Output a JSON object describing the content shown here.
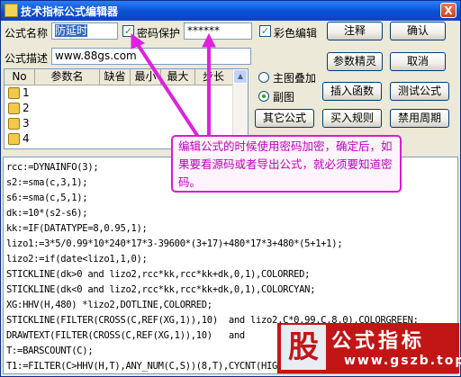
{
  "window": {
    "title": "技术指标公式编辑器",
    "close": "X"
  },
  "form": {
    "name_label": "公式名称",
    "name_value": "防延时",
    "password_protect_label": "密码保护",
    "password_value": "******",
    "color_edit_label": "彩色编辑",
    "desc_label": "公式描述",
    "desc_value": "www.88gs.com"
  },
  "buttons": {
    "annotate": "注释",
    "confirm": "确认",
    "param_wizard": "参数精灵",
    "cancel": "取消",
    "insert_function": "插入函数",
    "test_formula": "测试公式",
    "other_formula": "其它公式",
    "buy_rule": "买入规则",
    "disable_period": "禁用周期"
  },
  "chart_mode": {
    "main_overlay": "主图叠加",
    "subchart": "副图",
    "selected": "副图"
  },
  "param_table": {
    "headers": [
      "No",
      "参数名",
      "缺省",
      "最小",
      "最大",
      "步长"
    ],
    "rows": [
      "1",
      "2",
      "3",
      "4"
    ]
  },
  "callout": {
    "text": "编辑公式的时候使用密码加密，确定后，如果要看源码或者导出公式，就必须要知道密码。"
  },
  "code_lines": [
    "rcc:=DYNAINFO(3);",
    "s2:=sma(c,3,1);",
    "s6:=sma(c,5,1);",
    "dk:=10*(s2-s6);",
    "kk:=IF(DATATYPE=8,0.95,1);",
    "lizo1:=3*5/0.99*10*240*17*3-39600*(3+17)+480*17*3+480*(5+1+1);",
    "lizo2:=if(date<lizo1,1,0);",
    "STICKLINE(dk>0 and lizo2,rcc*kk,rcc*kk+dk,0,1),COLORRED;",
    "STICKLINE(dk<0 and lizo2,rcc*kk,rcc*kk+dk,0,1),COLORCYAN;",
    "XG:HHV(H,480) *lizo2,DOTLINE,COLORRED;",
    "STICKLINE(FILTER(CROSS(C,REF(XG,1)),10)  and lizo2,C*0.99,C,8,0),COLORGREEN;",
    "DRAWTEXT(FILTER(CROSS(C,REF(XG,1)),10)   and",
    "T:=BARSCOUNT(C);",
    "T1:=FILTER(C>HHV(H,T),ANY_NUM(C,S))(8,T),CYCNT(HIGH"
  ],
  "logo": {
    "glyph": "股",
    "name": "公式指标",
    "site": "www.gszb.top"
  },
  "colors": {
    "callout_border": "#d81ccf",
    "callout_text": "#c000c0",
    "titlebar": "#0a4fd6",
    "logo_bg": "#c21515"
  }
}
